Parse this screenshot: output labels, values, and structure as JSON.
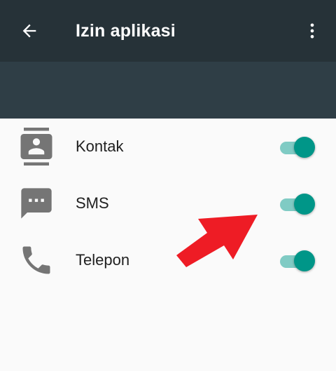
{
  "appbar": {
    "title": "Izin aplikasi",
    "back_icon": "arrow-back-icon",
    "more_icon": "more-vert-icon"
  },
  "permissions": [
    {
      "label": "Kontak",
      "icon": "contacts-icon",
      "enabled": true
    },
    {
      "label": "SMS",
      "icon": "sms-icon",
      "enabled": true
    },
    {
      "label": "Telepon",
      "icon": "phone-icon",
      "enabled": true
    }
  ],
  "colors": {
    "appbar": "#263238",
    "appbar_extension": "#2f3e46",
    "background": "#fafafa",
    "toggle_on_thumb": "#009688",
    "toggle_on_track": "#80cbc4",
    "icon": "#757575",
    "annotation_arrow": "#ee1c25"
  }
}
